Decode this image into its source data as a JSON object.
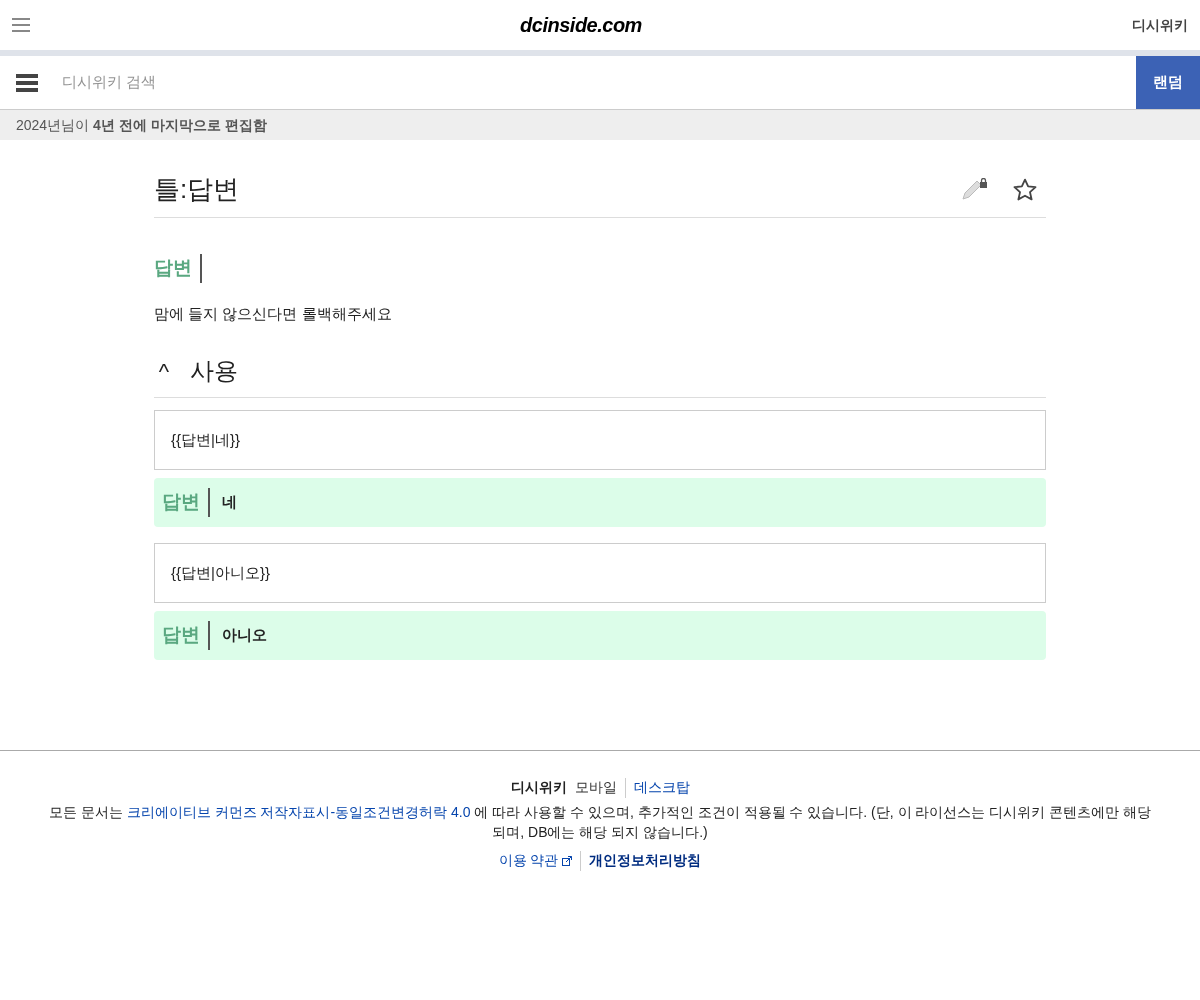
{
  "top_bar": {
    "logo": "dcinside.com",
    "wiki_link": "디시위키"
  },
  "search_bar": {
    "placeholder": "디시위키 검색",
    "random_button": "랜덤"
  },
  "edit_notice": "2024년님이 **4년 전에 마지막으로 편집함**",
  "page": {
    "title": "틀:답변",
    "template_preview": {
      "label": "답변"
    },
    "description": "맘에 들지 않으신다면 롤백해주세요",
    "section": {
      "toggle": "^",
      "heading": "사용",
      "expanded": true
    },
    "examples": [
      {
        "code": "{{답변|네}}",
        "label": "답변",
        "answer": "네"
      },
      {
        "code": "{{답변|아니오}}",
        "label": "답변",
        "answer": "아니오"
      }
    ]
  },
  "footer": {
    "site": "디시위키",
    "views": [
      {
        "label": "모바일",
        "selected": true
      },
      {
        "label": "데스크탑",
        "selected": false
      }
    ],
    "license_before": "모든 문서는",
    "license_link": "크리에이티브 커먼즈 저작자표시-동일조건변경허락 4.0",
    "license_after": "에 따라 사용할 수 있으며, 추가적인 조건이 적용될 수 있습니다. (단, 이 라이선스는 디시위키 콘텐츠에만 해당되며, DB에는 해당 되지 않습니다.)",
    "links": [
      {
        "label": "이용 약관",
        "external": true,
        "bold": false
      },
      {
        "label": "개인정보처리방침",
        "external": false,
        "bold": true
      }
    ]
  }
}
